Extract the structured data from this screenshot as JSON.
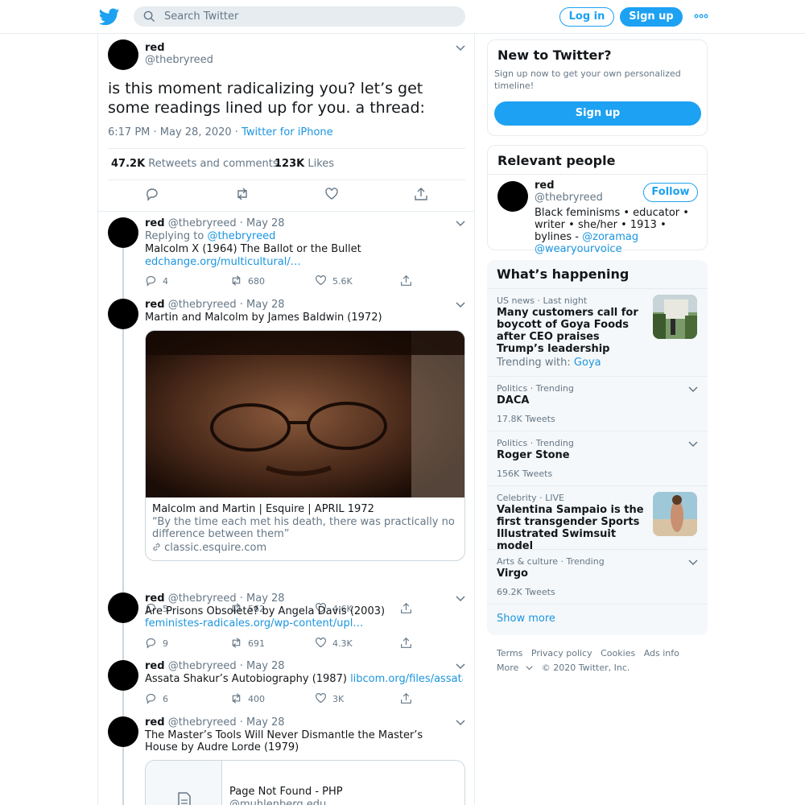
{
  "header": {
    "search_placeholder": "Search Twitter",
    "login_label": "Log in",
    "signup_label": "Sign up",
    "more_icon": "more-dots-icon",
    "brand_color": "#1da1f2"
  },
  "main_tweet": {
    "name": "red",
    "handle": "@thebryreed",
    "text": "is this moment radicalizing you? let’s get some readings lined up for you. a thread:",
    "timestamp": "6:17 PM · May 28, 2020 · ",
    "source": "Twitter for iPhone",
    "retweets_count": "47.2K",
    "retweets_label": "Retweets and comments",
    "likes_count": "123K",
    "likes_label": "Likes"
  },
  "replies": [
    {
      "name": "red",
      "handle_date": "@thebryreed · May 28",
      "replying_to_label": "Replying to ",
      "replying_to_handle": "@thebryreed",
      "text": "Malcolm X (1964) The Ballot or the Bullet",
      "link": "edchange.org/multicultural/…",
      "replies": "4",
      "retweets": "680",
      "likes": "5.6K"
    },
    {
      "name": "red",
      "handle_date": "@thebryreed · May 28",
      "text": "Martin and Malcolm by James Baldwin (1972)",
      "card_title": "Malcolm and Martin | Esquire | APRIL 1972",
      "card_desc": "“By the time each met his death, there was practically no difference between them”",
      "card_domain": "classic.esquire.com",
      "replies": "5",
      "retweets": "562",
      "likes": "4.6K"
    },
    {
      "name": "red",
      "handle_date": "@thebryreed · May 28",
      "text": "Are Prisons Obsolete? by Angela Davis  (2003) ",
      "link": "feministes-radicales.org/wp-content/upl…",
      "replies": "9",
      "retweets": "691",
      "likes": "4.3K"
    },
    {
      "name": "red",
      "handle_date": "@thebryreed · May 28",
      "text": "Assata Shakur’s Autobiography (1987) ",
      "link": "libcom.org/files/assataau…",
      "replies": "6",
      "retweets": "400",
      "likes": "3K"
    },
    {
      "name": "red",
      "handle_date": "@thebryreed · May 28",
      "text": "The Master’s Tools Will Never Dismantle the Master’s House by Audre Lorde (1979)",
      "card_title": "Page Not Found - PHP",
      "card_domain": "@muhlenberg.edu"
    }
  ],
  "sidebar": {
    "new_title": "New to Twitter?",
    "new_desc": "Sign up now to get your own personalized timeline!",
    "signup_label": "Sign up",
    "relevant_title": "Relevant people",
    "person": {
      "name": "red",
      "handle": "@thebryreed",
      "follow_label": "Follow",
      "bio": "Black feminisms • educator • writer • she/her • 1913 • bylines - ",
      "bio_link1": "@zoramag",
      "bio_link2": "@wearyourvoice"
    },
    "happening_title": "What’s happening",
    "trends": [
      {
        "context": "US news · Last night",
        "title": "Many customers call for boycott of Goya Foods after CEO praises Trump’s leadership",
        "extra_label": "Trending with: ",
        "extra_link": "Goya"
      },
      {
        "context": "Politics · Trending",
        "title": "DACA",
        "count": "17.8K Tweets"
      },
      {
        "context": "Politics · Trending",
        "title": "Roger Stone",
        "count": "156K Tweets"
      },
      {
        "context": "Celebrity · LIVE",
        "title": "Valentina Sampaio is the first transgender Sports Illustrated Swimsuit model"
      },
      {
        "context": "Arts & culture · Trending",
        "title": "Virgo",
        "count": "69.2K Tweets"
      }
    ],
    "show_more": "Show more"
  },
  "footer": {
    "links": [
      "Terms",
      "Privacy policy",
      "Cookies",
      "Ads info"
    ],
    "more": "More",
    "copyright": "© 2020 Twitter, Inc."
  }
}
